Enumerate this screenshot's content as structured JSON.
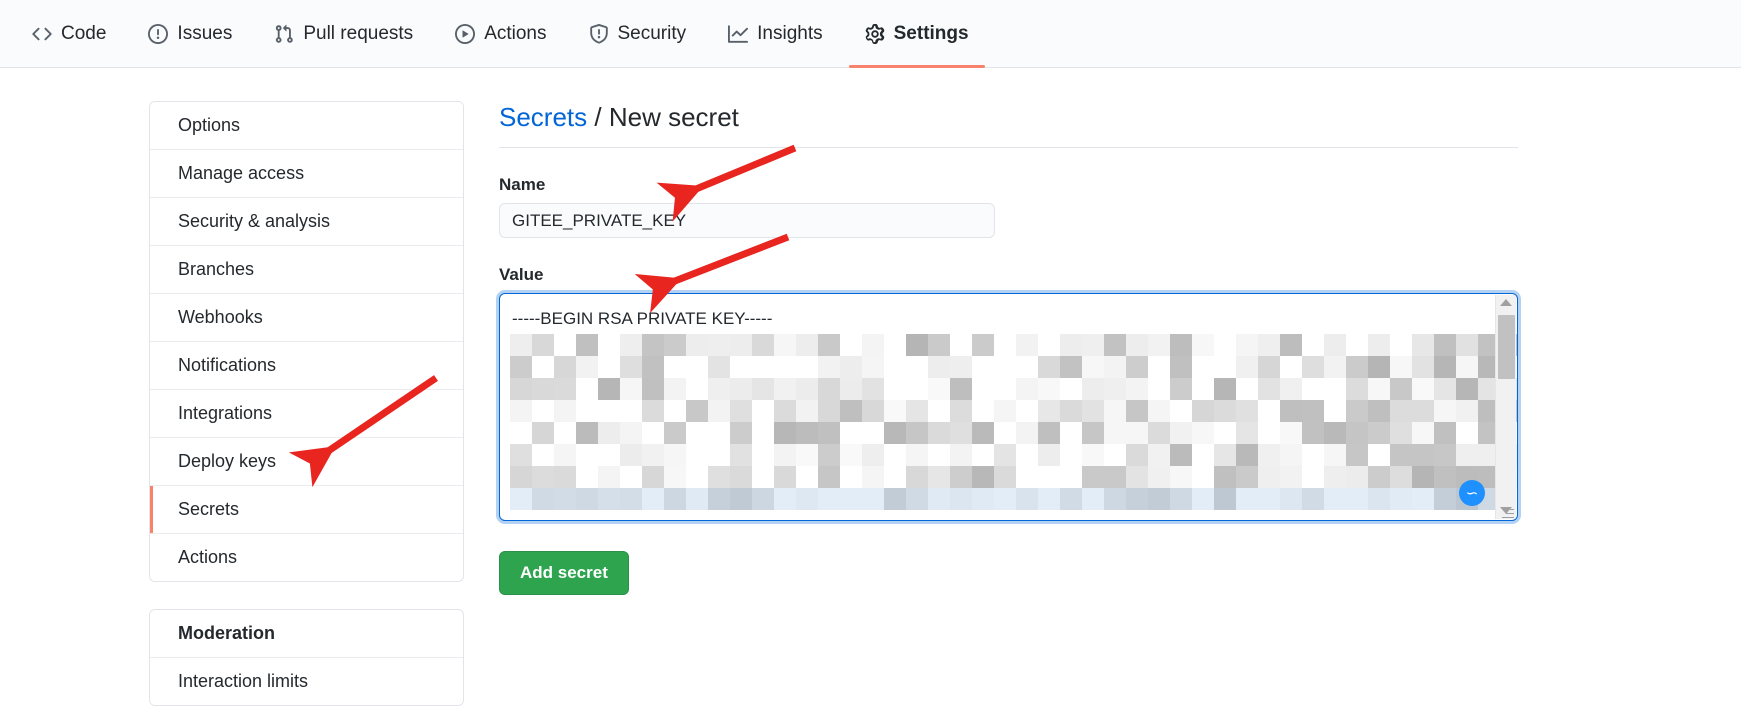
{
  "repo_nav": {
    "items": [
      {
        "label": "Code",
        "icon": "code-icon",
        "active": false
      },
      {
        "label": "Issues",
        "icon": "issue-opened-icon",
        "active": false
      },
      {
        "label": "Pull requests",
        "icon": "git-pull-request-icon",
        "active": false
      },
      {
        "label": "Actions",
        "icon": "play-icon",
        "active": false
      },
      {
        "label": "Security",
        "icon": "shield-icon",
        "active": false
      },
      {
        "label": "Insights",
        "icon": "graph-icon",
        "active": false
      },
      {
        "label": "Settings",
        "icon": "gear-icon",
        "active": true
      }
    ],
    "active_indicator_color": "#f9826c"
  },
  "sidebar": {
    "primary_items": [
      {
        "label": "Options",
        "selected": false
      },
      {
        "label": "Manage access",
        "selected": false
      },
      {
        "label": "Security & analysis",
        "selected": false
      },
      {
        "label": "Branches",
        "selected": false
      },
      {
        "label": "Webhooks",
        "selected": false
      },
      {
        "label": "Notifications",
        "selected": false
      },
      {
        "label": "Integrations",
        "selected": false
      },
      {
        "label": "Deploy keys",
        "selected": false
      },
      {
        "label": "Secrets",
        "selected": true
      },
      {
        "label": "Actions",
        "selected": false
      }
    ],
    "secondary_items": [
      {
        "label": "Moderation",
        "heading": true
      },
      {
        "label": "Interaction limits",
        "heading": false
      }
    ],
    "selected_marker_color": "#f9826c"
  },
  "main": {
    "breadcrumb": {
      "parent": "Secrets",
      "separator": "/",
      "current": "New secret",
      "link_color": "#0366d6"
    },
    "name_field": {
      "label": "Name",
      "value": "GITEE_PRIVATE_KEY",
      "placeholder": ""
    },
    "value_field": {
      "label": "Value",
      "first_line": "-----BEGIN RSA PRIVATE KEY-----",
      "body_note": "redacted",
      "focused": true,
      "focus_ring_color": "#0366d6"
    },
    "scrollbar": {
      "up_arrow_icon": "triangle-up-icon",
      "down_arrow_icon": "triangle-down-icon"
    },
    "assistant_badge": {
      "icon": "wave-icon",
      "color": "#1e90ff"
    },
    "submit_button": {
      "label": "Add secret",
      "color": "#2ea44f"
    }
  },
  "annotations": {
    "color": "#e8251f",
    "arrows": [
      {
        "target": "secrets-sidebar-item",
        "name": "arrow-to-secrets"
      },
      {
        "target": "name-input",
        "name": "arrow-to-name-input"
      },
      {
        "target": "value-textarea",
        "name": "arrow-to-value-textarea"
      }
    ]
  }
}
